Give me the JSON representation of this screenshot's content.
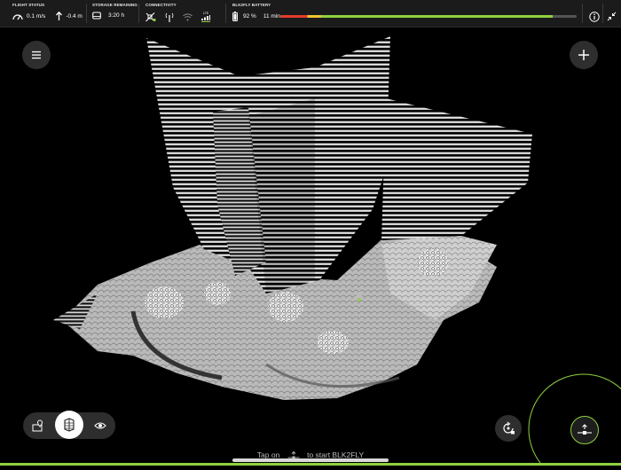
{
  "flight_status": {
    "title": "FLIGHT STATUS",
    "speed": "0.1 m/s",
    "altitude": "-0.4 m"
  },
  "storage": {
    "title": "STORAGE REMAINING",
    "value": "3:20 h"
  },
  "connectivity": {
    "title": "CONNECTIVITY",
    "lte_label": "LTE"
  },
  "battery": {
    "title": "BLK2FLY BATTERY",
    "percent": "92 %",
    "time": "11 min",
    "level": 0.92,
    "colors": {
      "low": "#e53b2f",
      "mid": "#f0c431",
      "high": "#8fd13f"
    }
  },
  "hint": {
    "prefix": "Tap on",
    "suffix": "to start BLK2FLY"
  },
  "icons": {
    "speed": "speedometer-icon",
    "altitude": "altitude-arrow-icon",
    "storage": "storage-drive-icon",
    "satellite": "satellite-off-icon",
    "antenna": "antenna-icon",
    "wifi": "wifi-icon",
    "lte": "lte-signal-icon",
    "battery": "battery-icon",
    "info": "info-icon",
    "collapse": "collapse-arrows-icon",
    "menu": "hamburger-menu-icon",
    "add": "plus-icon",
    "map_pin": "map-marker-icon",
    "layers": "pointcloud-layers-icon",
    "eye": "eye-icon",
    "rotate_lock": "rotate-lock-icon",
    "drone": "drone-icon"
  },
  "theme": {
    "accent": "#8fd13f",
    "bar": "#1b1b1b"
  }
}
